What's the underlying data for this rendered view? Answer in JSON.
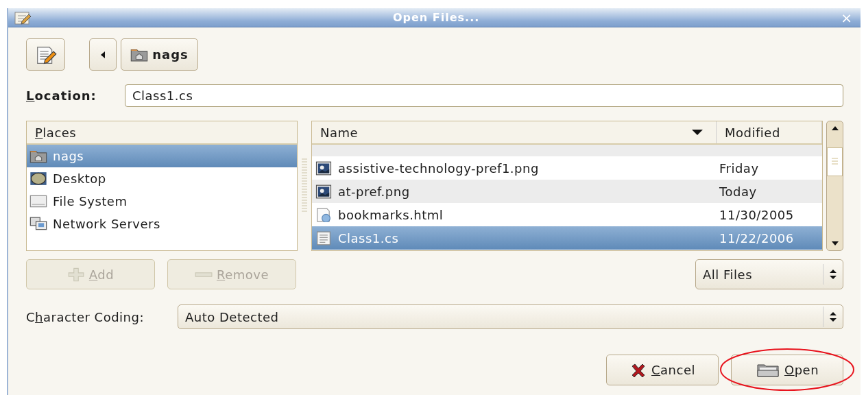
{
  "window": {
    "title": "Open Files...",
    "close": "×"
  },
  "toolbar": {
    "path_button": "nags"
  },
  "location": {
    "label": {
      "key": "L",
      "post": "ocation:"
    },
    "value": "Class1.cs"
  },
  "places": {
    "header": {
      "key": "P",
      "post": "laces"
    },
    "items": [
      {
        "name": "nags",
        "kind": "home",
        "selected": true
      },
      {
        "name": "Desktop",
        "kind": "desktop",
        "selected": false
      },
      {
        "name": "File System",
        "kind": "drive",
        "selected": false
      },
      {
        "name": "Network Servers",
        "kind": "network",
        "selected": false
      }
    ]
  },
  "places_buttons": [
    {
      "label": {
        "key": "A",
        "post": "dd"
      },
      "kind": "add",
      "disabled": true
    },
    {
      "label": {
        "key": "R",
        "post": "emove"
      },
      "kind": "remove",
      "disabled": true
    }
  ],
  "files": {
    "columns": [
      {
        "title": "Name",
        "sorted": true
      },
      {
        "title": "Modified",
        "sorted": false
      }
    ],
    "rows": [
      {
        "name": "assistive-technology-pref1.png",
        "modified": "Friday",
        "kind": "image",
        "selected": false
      },
      {
        "name": "at-pref.png",
        "modified": "Today",
        "kind": "image",
        "selected": false
      },
      {
        "name": "bookmarks.html",
        "modified": "11/30/2005",
        "kind": "html",
        "selected": false
      },
      {
        "name": "Class1.cs",
        "modified": "11/22/2006",
        "kind": "text",
        "selected": true
      }
    ]
  },
  "filter": {
    "value": "All Files"
  },
  "encoding": {
    "label": {
      "pre": "C",
      "key": "h",
      "post": "aracter Coding:"
    },
    "value": "Auto Detected"
  },
  "buttons": [
    {
      "label": {
        "key": "C",
        "post": "ancel"
      },
      "kind": "cancel",
      "circled": false
    },
    {
      "label": {
        "key": "O",
        "post": "pen"
      },
      "kind": "open",
      "circled": true
    }
  ]
}
